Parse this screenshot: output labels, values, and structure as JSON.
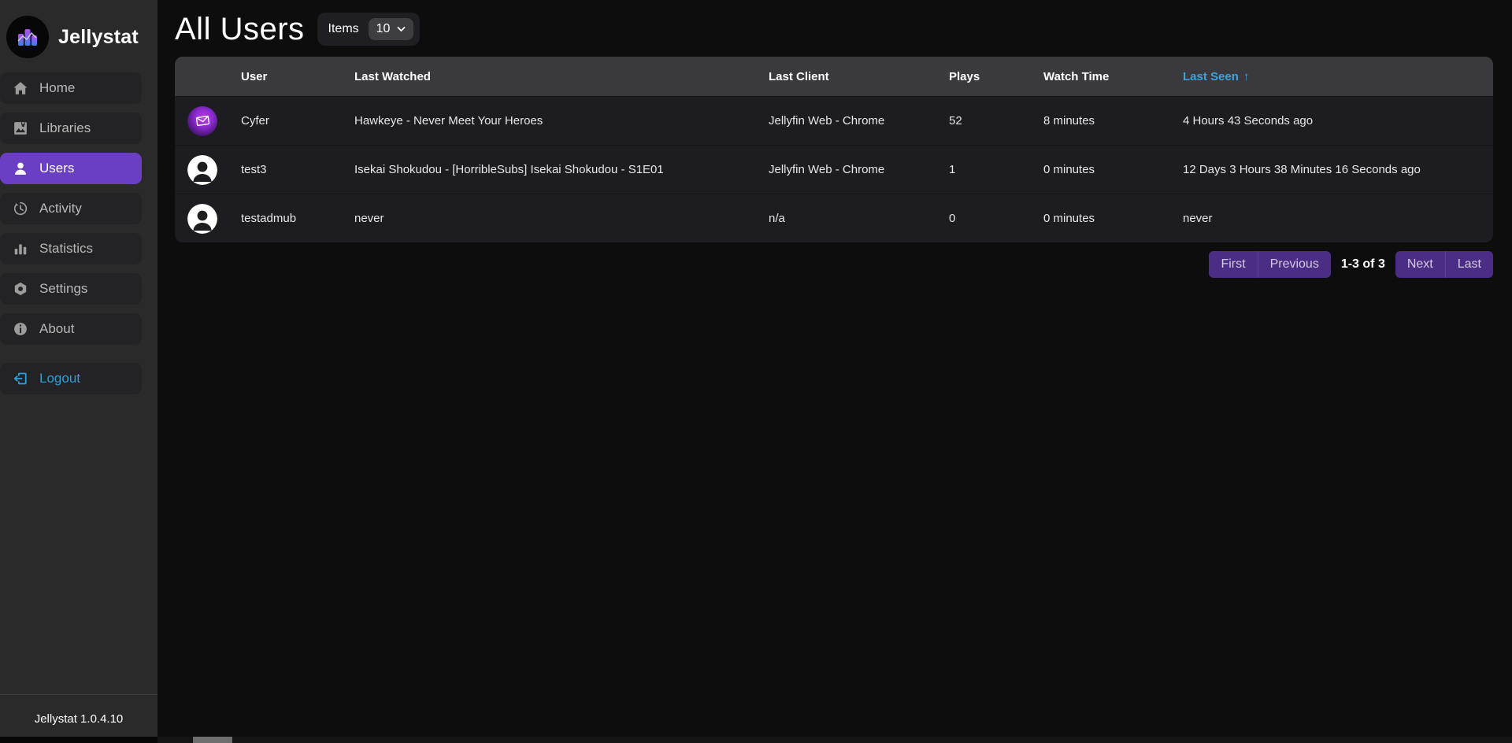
{
  "app": {
    "name": "Jellystat",
    "version_label": "Jellystat 1.0.4.10"
  },
  "sidebar": {
    "items": [
      {
        "label": "Home",
        "icon": "home-icon",
        "active": false
      },
      {
        "label": "Libraries",
        "icon": "libraries-icon",
        "active": false
      },
      {
        "label": "Users",
        "icon": "person-icon",
        "active": true
      },
      {
        "label": "Activity",
        "icon": "history-clock-icon",
        "active": false
      },
      {
        "label": "Statistics",
        "icon": "bar-chart-icon",
        "active": false
      },
      {
        "label": "Settings",
        "icon": "nut-icon",
        "active": false
      },
      {
        "label": "About",
        "icon": "info-circle-icon",
        "active": false
      }
    ],
    "logout_label": "Logout"
  },
  "header": {
    "title": "All Users",
    "items_label": "Items",
    "items_per_page": "10"
  },
  "table": {
    "columns": [
      "User",
      "Last Watched",
      "Last Client",
      "Plays",
      "Watch Time",
      "Last Seen"
    ],
    "sort_column": "Last Seen",
    "sort_direction": "ascending",
    "sort_arrow": "↑",
    "rows": [
      {
        "user": "Cyfer",
        "avatar": "custom-gradient",
        "last_watched": "Hawkeye - Never Meet Your Heroes",
        "last_client": "Jellyfin Web - Chrome",
        "plays": "52",
        "watch_time": "8 minutes",
        "last_seen": "4 Hours 43 Seconds ago"
      },
      {
        "user": "test3",
        "avatar": "default",
        "last_watched": "Isekai Shokudou - [HorribleSubs] Isekai Shokudou - S1E01",
        "last_client": "Jellyfin Web - Chrome",
        "plays": "1",
        "watch_time": "0 minutes",
        "last_seen": "12 Days 3 Hours 38 Minutes 16 Seconds ago"
      },
      {
        "user": "testadmub",
        "avatar": "default",
        "last_watched": "never",
        "last_client": "n/a",
        "plays": "0",
        "watch_time": "0 minutes",
        "last_seen": "never"
      }
    ]
  },
  "pagination": {
    "first": "First",
    "previous": "Previous",
    "range": "1-3 of 3",
    "next": "Next",
    "last": "Last"
  },
  "colors": {
    "accent_purple": "#6b3fc4",
    "pagination_purple": "#4c2d86",
    "link_blue": "#3ba3dd",
    "logout_blue": "#2f9fd9",
    "sidebar_bg": "#2a2a2b",
    "main_bg": "#0d0d0d",
    "table_header_bg": "#3a3a3e",
    "table_row_bg": "#1d1d21"
  }
}
